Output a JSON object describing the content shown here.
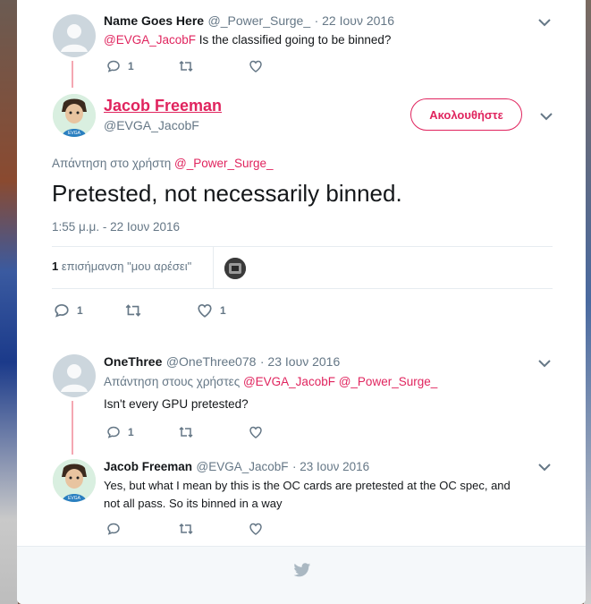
{
  "colors": {
    "accent": "#e0245e",
    "muted": "#657786",
    "thread_line": "#f4a7b2"
  },
  "tweets": [
    {
      "name": "Name Goes Here",
      "handle": "@_Power_Surge_",
      "date": "· 22 Ιουν 2016",
      "mention": "@EVGA_JacobF",
      "text": " Is the classified going to be binned?",
      "reply_count": "1",
      "avatar_icon": "default-avatar-icon"
    }
  ],
  "main_tweet": {
    "name": "Jacob Freeman",
    "handle": "@EVGA_JacobF",
    "follow_label": "Ακολουθήστε",
    "reply_to_label": "Απάντηση στο χρήστη ",
    "reply_to_mention": "@_Power_Surge_",
    "text": "Pretested, not necessarily binned.",
    "timestamp": "1:55 μ.μ. - 22 Ιουν 2016",
    "likes_count": "1",
    "likes_label": " επισήμανση \"μου αρέσει\"",
    "reply_count": "1",
    "like_count": "1",
    "avatar_badge": "EVGA"
  },
  "replies": [
    {
      "name": "OneThree",
      "handle": "@OneThree078",
      "date": "· 23 Ιουν 2016",
      "reply_to_label": "Απάντηση στους χρήστες ",
      "mention1": "@EVGA_JacobF",
      "mention2": "@_Power_Surge_",
      "text": "Isn't every GPU pretested?",
      "reply_count": "1"
    },
    {
      "name": "Jacob Freeman",
      "handle": "@EVGA_JacobF",
      "date": "· 23 Ιουν 2016",
      "text_line1": "Yes, but what I mean by this is the OC cards are pretested at the OC spec, and",
      "text_line2": "not all pass. So its binned in a way",
      "avatar_badge": "EVGA"
    }
  ],
  "footer": {
    "icon": "twitter-bird-icon"
  }
}
